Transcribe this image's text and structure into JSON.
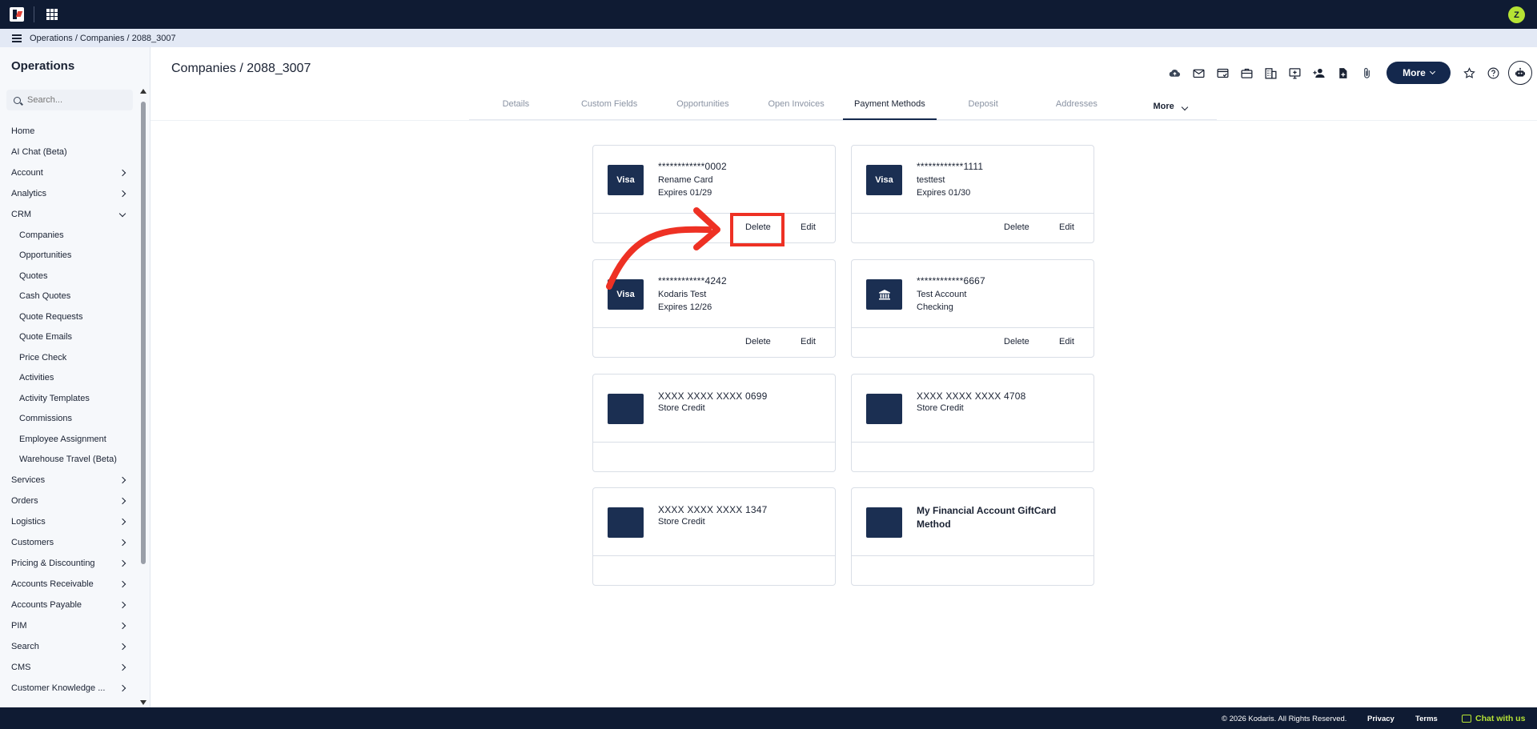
{
  "app": {
    "avatar_initial": "Z"
  },
  "breadcrumb": [
    "Operations",
    "/",
    "Companies",
    "/",
    "2088_3007"
  ],
  "sidebar": {
    "title": "Operations",
    "search_placeholder": "Search...",
    "items_top": [
      {
        "label": "Home",
        "chevron": "none"
      },
      {
        "label": "AI Chat (Beta)",
        "chevron": "none"
      },
      {
        "label": "Account",
        "chevron": "right"
      },
      {
        "label": "Analytics",
        "chevron": "right"
      },
      {
        "label": "CRM",
        "chevron": "down"
      }
    ],
    "crm_children": [
      "Companies",
      "Opportunities",
      "Quotes",
      "Cash Quotes",
      "Quote Requests",
      "Quote Emails",
      "Price Check",
      "Activities",
      "Activity Templates",
      "Commissions",
      "Employee Assignment",
      "Warehouse Travel (Beta)"
    ],
    "items_bottom": [
      "Services",
      "Orders",
      "Logistics",
      "Customers",
      "Pricing & Discounting",
      "Accounts Receivable",
      "Accounts Payable",
      "PIM",
      "Search",
      "CMS",
      "Customer Knowledge ..."
    ]
  },
  "header": {
    "title": "Companies / 2088_3007",
    "more_label": "More",
    "toolbar_icons": [
      "cloud-upload-icon",
      "mail-icon",
      "card-check-icon",
      "briefcase-icon",
      "building-icon",
      "monitor-plus-icon",
      "person-add-icon",
      "file-plus-icon",
      "paperclip-icon"
    ]
  },
  "tabs": [
    {
      "label": "Details",
      "active": false
    },
    {
      "label": "Custom Fields",
      "active": false
    },
    {
      "label": "Opportunities",
      "active": false
    },
    {
      "label": "Open Invoices",
      "active": false
    },
    {
      "label": "Payment Methods",
      "active": true
    },
    {
      "label": "Deposit",
      "active": false
    },
    {
      "label": "Addresses",
      "active": false
    }
  ],
  "tabs_more_label": "More",
  "cards": [
    {
      "badge": "Visa",
      "number": "************0002",
      "line1": "Rename Card",
      "line2": "Expires 01/29",
      "delete": "Delete",
      "edit": "Edit"
    },
    {
      "badge": "Visa",
      "number": "************1111",
      "line1": "testtest",
      "line2": "Expires 01/30",
      "delete": "Delete",
      "edit": "Edit"
    },
    {
      "badge": "Visa",
      "number": "************4242",
      "line1": "Kodaris Test",
      "line2": "Expires 12/26",
      "delete": "Delete",
      "edit": "Edit"
    },
    {
      "badge": "",
      "icon": "bank-icon",
      "number": "************6667",
      "line1": "Test Account",
      "line2": "Checking",
      "delete": "Delete",
      "edit": "Edit"
    },
    {
      "badge": "",
      "number": "XXXX XXXX XXXX 0699",
      "line1": "Store Credit"
    },
    {
      "badge": "",
      "number": "XXXX XXXX XXXX 4708",
      "line1": "Store Credit"
    },
    {
      "badge": "",
      "number": "XXXX XXXX XXXX 1347",
      "line1": "Store Credit"
    },
    {
      "badge": "",
      "name": "My Financial Account GiftCard Method"
    }
  ],
  "footer": {
    "copyright": "© 2026 Kodaris. All Rights Reserved.",
    "privacy": "Privacy",
    "terms": "Terms",
    "chat": "Chat with us"
  },
  "colors": {
    "nav_dark": "#0f1b33",
    "accent": "#14284d",
    "highlight": "#ee3124",
    "chat_green": "#b6e334"
  }
}
